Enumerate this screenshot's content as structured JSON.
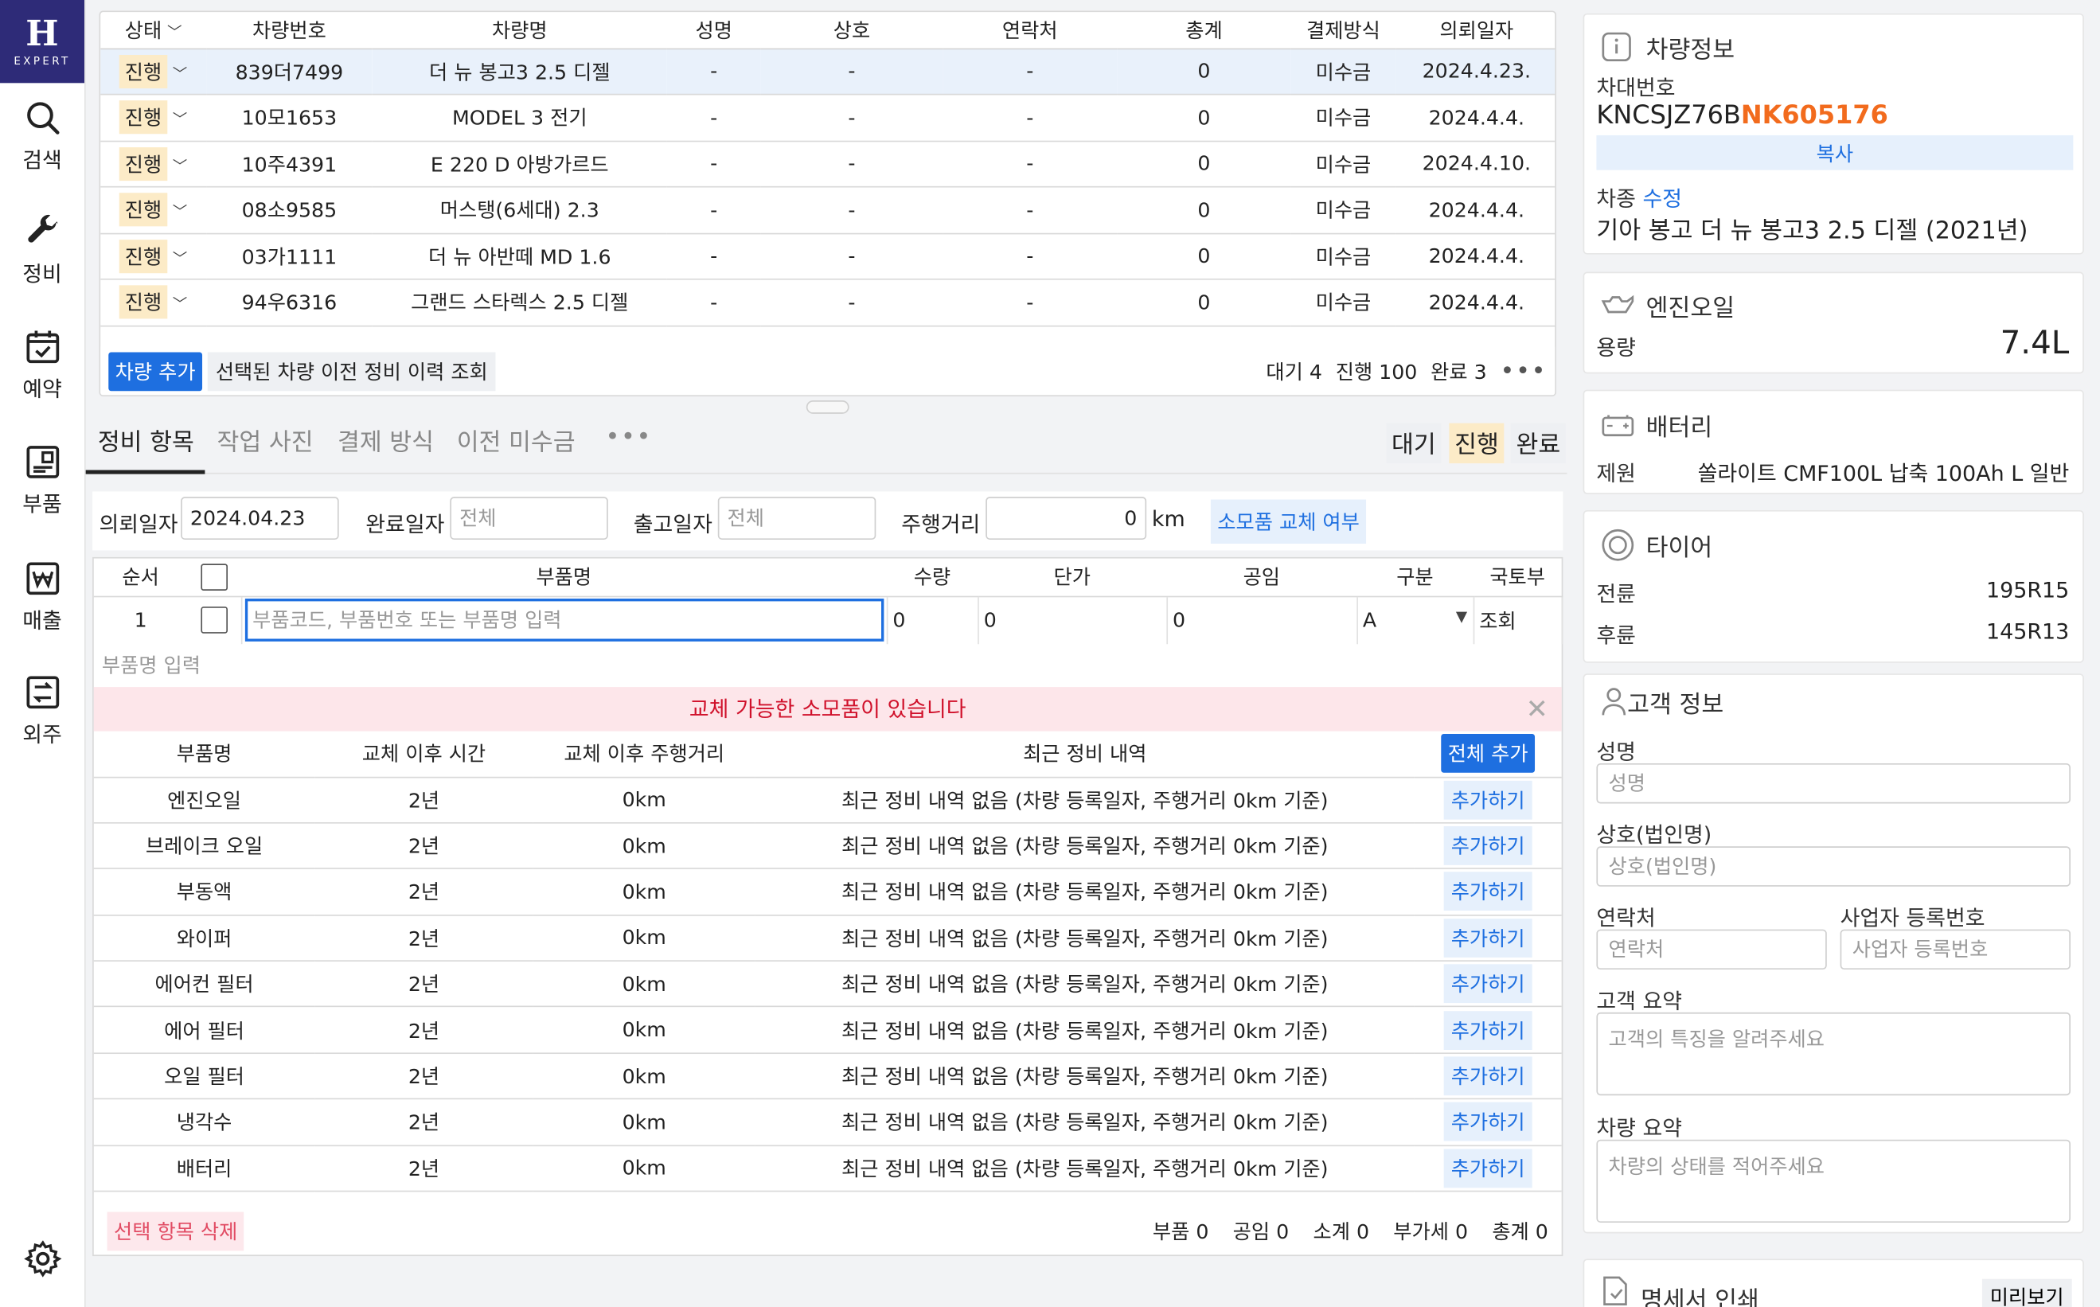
{
  "sidebar": {
    "logo_letter": "H",
    "logo_text": "EXPERT",
    "items": [
      {
        "label": "검색",
        "icon": "search-icon"
      },
      {
        "label": "정비",
        "icon": "wrench-icon"
      },
      {
        "label": "예약",
        "icon": "calendar-check-icon"
      },
      {
        "label": "부품",
        "icon": "parts-icon"
      },
      {
        "label": "매출",
        "icon": "won-sales-icon"
      },
      {
        "label": "외주",
        "icon": "outsource-icon"
      }
    ],
    "settings_icon": "gear-icon"
  },
  "vehicles": {
    "headers": [
      "상태",
      "차량번호",
      "차량명",
      "성명",
      "상호",
      "연락처",
      "총계",
      "결제방식",
      "의뢰일자"
    ],
    "rows": [
      {
        "status": "진행",
        "plate": "839더7499",
        "name": "더 뉴 봉고3 2.5 디젤",
        "owner": "-",
        "company": "-",
        "contact": "-",
        "total": "0",
        "payment": "미수금",
        "date": "2024.4.23."
      },
      {
        "status": "진행",
        "plate": "10모1653",
        "name": "MODEL 3 전기",
        "owner": "-",
        "company": "-",
        "contact": "-",
        "total": "0",
        "payment": "미수금",
        "date": "2024.4.4."
      },
      {
        "status": "진행",
        "plate": "10주4391",
        "name": "E 220 D 아방가르드",
        "owner": "-",
        "company": "-",
        "contact": "-",
        "total": "0",
        "payment": "미수금",
        "date": "2024.4.10."
      },
      {
        "status": "진행",
        "plate": "08소9585",
        "name": "머스탱(6세대) 2.3",
        "owner": "-",
        "company": "-",
        "contact": "-",
        "total": "0",
        "payment": "미수금",
        "date": "2024.4.4."
      },
      {
        "status": "진행",
        "plate": "03가1111",
        "name": "더 뉴 아반떼 MD 1.6",
        "owner": "-",
        "company": "-",
        "contact": "-",
        "total": "0",
        "payment": "미수금",
        "date": "2024.4.4."
      },
      {
        "status": "진행",
        "plate": "94우6316",
        "name": "그랜드 스타렉스 2.5 디젤",
        "owner": "-",
        "company": "-",
        "contact": "-",
        "total": "0",
        "payment": "미수금",
        "date": "2024.4.4."
      }
    ],
    "add_button": "차량 추가",
    "history_button": "선택된 차량 이전 정비 이력 조회",
    "count_wait": "대기 4",
    "count_progress": "진행 100",
    "count_done": "완료 3",
    "more": "•••"
  },
  "tabs": {
    "items": [
      "정비 항목",
      "작업 사진",
      "결제 방식",
      "이전 미수금"
    ],
    "more": "•••",
    "status_wait": "대기",
    "status_progress": "진행",
    "status_done": "완료"
  },
  "form": {
    "request_date_label": "의뢰일자",
    "request_date_value": "2024.04.23",
    "complete_date_label": "완료일자",
    "complete_date_placeholder": "전체",
    "release_date_label": "출고일자",
    "release_date_placeholder": "전체",
    "mileage_label": "주행거리",
    "mileage_value": "0",
    "mileage_unit": "km",
    "consumable_button": "소모품 교체 여부"
  },
  "parts": {
    "headers": [
      "순서",
      "부품명",
      "수량",
      "단가",
      "공임",
      "구분",
      "국토부"
    ],
    "row": {
      "order": "1",
      "input_placeholder": "부품코드, 부품번호 또는 부품명 입력",
      "qty": "0",
      "price": "0",
      "labor": "0",
      "category": "A",
      "lookup": "조회"
    },
    "sub_placeholder": "부품명 입력",
    "alert": "교체 가능한 소모품이 있습니다",
    "cons_headers": [
      "부품명",
      "교체 이후 시간",
      "교체 이후 주행거리",
      "최근 정비 내역"
    ],
    "add_all": "전체 추가",
    "consumables": [
      {
        "name": "엔진오일",
        "time": "2년",
        "km": "0km",
        "history": "최근 정비 내역 없음 (차량 등록일자, 주행거리 0km 기준)",
        "action": "추가하기"
      },
      {
        "name": "브레이크 오일",
        "time": "2년",
        "km": "0km",
        "history": "최근 정비 내역 없음 (차량 등록일자, 주행거리 0km 기준)",
        "action": "추가하기"
      },
      {
        "name": "부동액",
        "time": "2년",
        "km": "0km",
        "history": "최근 정비 내역 없음 (차량 등록일자, 주행거리 0km 기준)",
        "action": "추가하기"
      },
      {
        "name": "와이퍼",
        "time": "2년",
        "km": "0km",
        "history": "최근 정비 내역 없음 (차량 등록일자, 주행거리 0km 기준)",
        "action": "추가하기"
      },
      {
        "name": "에어컨 필터",
        "time": "2년",
        "km": "0km",
        "history": "최근 정비 내역 없음 (차량 등록일자, 주행거리 0km 기준)",
        "action": "추가하기"
      },
      {
        "name": "에어 필터",
        "time": "2년",
        "km": "0km",
        "history": "최근 정비 내역 없음 (차량 등록일자, 주행거리 0km 기준)",
        "action": "추가하기"
      },
      {
        "name": "오일 필터",
        "time": "2년",
        "km": "0km",
        "history": "최근 정비 내역 없음 (차량 등록일자, 주행거리 0km 기준)",
        "action": "추가하기"
      },
      {
        "name": "냉각수",
        "time": "2년",
        "km": "0km",
        "history": "최근 정비 내역 없음 (차량 등록일자, 주행거리 0km 기준)",
        "action": "추가하기"
      },
      {
        "name": "배터리",
        "time": "2년",
        "km": "0km",
        "history": "최근 정비 내역 없음 (차량 등록일자, 주행거리 0km 기준)",
        "action": "추가하기"
      }
    ],
    "delete_button": "선택 항목 삭제",
    "totals": [
      "부품 0",
      "공임 0",
      "소계 0",
      "부가세 0",
      "총계 0"
    ]
  },
  "vehicle_info": {
    "title": "차량정보",
    "vin_label": "차대번호",
    "vin_prefix": "KNCSJZ76B",
    "vin_highlight": "NK605176",
    "copy_button": "복사",
    "model_label": "차종",
    "edit_link": "수정",
    "model_value": "기아 봉고 더 뉴 봉고3 2.5 디젤 (2021년)"
  },
  "engine_oil": {
    "title": "엔진오일",
    "capacity_label": "용량",
    "capacity_value": "7.4L"
  },
  "battery": {
    "title": "배터리",
    "spec_label": "제원",
    "spec_value": "쏠라이트 CMF100L 납축 100Ah L 일반"
  },
  "tire": {
    "title": "타이어",
    "front_label": "전륜",
    "front_value": "195R15",
    "rear_label": "후륜",
    "rear_value": "145R13"
  },
  "customer": {
    "title": "고객 정보",
    "name_label": "성명",
    "name_placeholder": "성명",
    "company_label": "상호(법인명)",
    "company_placeholder": "상호(법인명)",
    "contact_label": "연락처",
    "contact_placeholder": "연락처",
    "biz_label": "사업자 등록번호",
    "biz_placeholder": "사업자 등록번호",
    "summary_label": "고객 요약",
    "summary_placeholder": "고객의 특징을 알려주세요",
    "car_summary_label": "차량 요약",
    "car_summary_placeholder": "차량의 상태를 적어주세요"
  },
  "invoice": {
    "title": "명세서 인쇄",
    "preview_button": "미리보기"
  },
  "colors": {
    "brand": "#2e2b78",
    "accent": "#1e6fe0",
    "vin_highlight": "#f26b1d",
    "alert": "#d0112b",
    "status_badge": "#fcebc7"
  }
}
